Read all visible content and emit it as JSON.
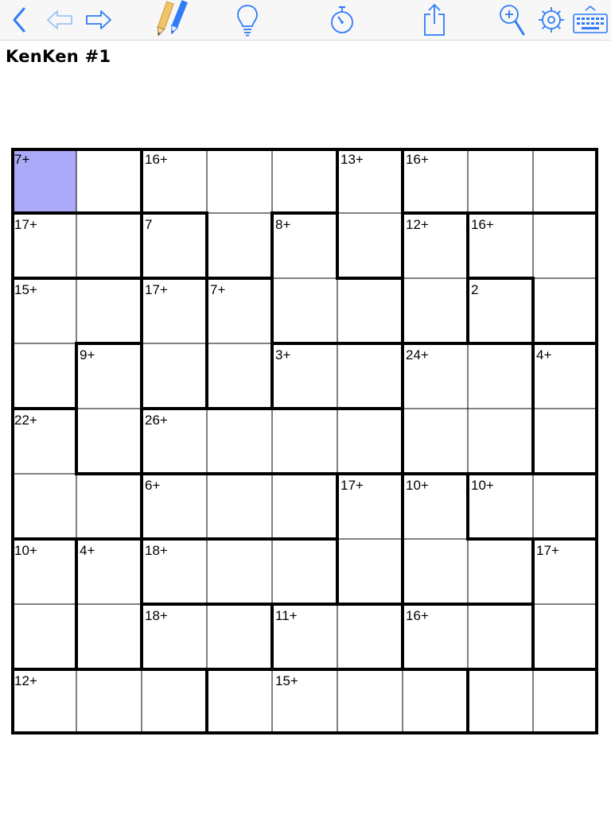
{
  "toolbar": {
    "back": "back-icon",
    "undo": "undo-arrow-icon",
    "redo": "redo-arrow-icon",
    "pencil": "pencil-icon",
    "hint": "lightbulb-icon",
    "timer": "stopwatch-icon",
    "share": "share-icon",
    "zoom": "zoom-in-icon",
    "settings": "gear-icon",
    "keyboard": "keyboard-icon",
    "accent_color": "#2f7cf6"
  },
  "puzzle": {
    "title": "KenKen #1",
    "size": 9,
    "selected_cell": [
      0,
      0
    ],
    "selected_color": "#aaaaf8",
    "cages": [
      {
        "label": "7+",
        "cells": [
          [
            0,
            0
          ],
          [
            1,
            0
          ]
        ]
      },
      {
        "label": "16+",
        "cells": [
          [
            0,
            1
          ],
          [
            0,
            2
          ],
          [
            0,
            3
          ],
          [
            0,
            4
          ],
          [
            0,
            5
          ],
          [
            0,
            6
          ],
          [
            0,
            7
          ],
          [
            0,
            8
          ]
        ]
      },
      {
        "label": "16+",
        "cells": [
          [
            0,
            2
          ],
          [
            0,
            3
          ],
          [
            0,
            4
          ],
          [
            1,
            3
          ]
        ]
      },
      {
        "label": "13+",
        "cells": [
          [
            0,
            5
          ],
          [
            1,
            5
          ]
        ]
      },
      {
        "label": "16+",
        "cells": [
          [
            0,
            6
          ],
          [
            0,
            7
          ],
          [
            0,
            8
          ]
        ]
      },
      {
        "label": "17+",
        "cells": [
          [
            1,
            0
          ],
          [
            1,
            1
          ]
        ]
      },
      {
        "label": "7",
        "cells": [
          [
            1,
            2
          ]
        ]
      },
      {
        "label": "8+",
        "cells": [
          [
            1,
            4
          ],
          [
            2,
            4
          ],
          [
            2,
            5
          ]
        ]
      },
      {
        "label": "12+",
        "cells": [
          [
            1,
            6
          ],
          [
            2,
            6
          ]
        ]
      },
      {
        "label": "16+",
        "cells": [
          [
            1,
            7
          ],
          [
            1,
            8
          ],
          [
            2,
            8
          ]
        ]
      },
      {
        "label": "15+",
        "cells": [
          [
            2,
            0
          ],
          [
            2,
            1
          ],
          [
            3,
            0
          ]
        ]
      },
      {
        "label": "17+",
        "cells": [
          [
            2,
            2
          ],
          [
            3,
            2
          ]
        ]
      },
      {
        "label": "7+",
        "cells": [
          [
            2,
            3
          ],
          [
            3,
            3
          ]
        ]
      },
      {
        "label": "2",
        "cells": [
          [
            2,
            7
          ]
        ]
      },
      {
        "label": "9+",
        "cells": [
          [
            3,
            1
          ],
          [
            4,
            1
          ]
        ]
      },
      {
        "label": "3+",
        "cells": [
          [
            3,
            4
          ],
          [
            3,
            5
          ]
        ]
      },
      {
        "label": "24+",
        "cells": [
          [
            3,
            6
          ],
          [
            3,
            7
          ],
          [
            4,
            6
          ],
          [
            4,
            7
          ]
        ]
      },
      {
        "label": "4+",
        "cells": [
          [
            3,
            8
          ],
          [
            4,
            8
          ]
        ]
      },
      {
        "label": "22+",
        "cells": [
          [
            4,
            0
          ],
          [
            5,
            0
          ],
          [
            5,
            1
          ]
        ]
      },
      {
        "label": "26+",
        "cells": [
          [
            4,
            2
          ],
          [
            4,
            3
          ],
          [
            4,
            4
          ],
          [
            4,
            5
          ]
        ]
      },
      {
        "label": "6+",
        "cells": [
          [
            5,
            2
          ],
          [
            5,
            3
          ],
          [
            5,
            4
          ]
        ]
      },
      {
        "label": "17+",
        "cells": [
          [
            5,
            5
          ],
          [
            6,
            5
          ]
        ]
      },
      {
        "label": "10+",
        "cells": [
          [
            5,
            6
          ],
          [
            6,
            6
          ],
          [
            6,
            7
          ]
        ]
      },
      {
        "label": "10+",
        "cells": [
          [
            5,
            7
          ],
          [
            5,
            8
          ]
        ]
      },
      {
        "label": "10+",
        "cells": [
          [
            6,
            0
          ],
          [
            7,
            0
          ]
        ]
      },
      {
        "label": "4+",
        "cells": [
          [
            6,
            1
          ],
          [
            7,
            1
          ]
        ]
      },
      {
        "label": "18+",
        "cells": [
          [
            6,
            2
          ],
          [
            6,
            3
          ],
          [
            6,
            4
          ]
        ]
      },
      {
        "label": "17+",
        "cells": [
          [
            6,
            8
          ],
          [
            7,
            8
          ]
        ]
      },
      {
        "label": "18+",
        "cells": [
          [
            7,
            2
          ],
          [
            7,
            3
          ]
        ]
      },
      {
        "label": "11+",
        "cells": [
          [
            7,
            4
          ],
          [
            7,
            5
          ]
        ]
      },
      {
        "label": "16+",
        "cells": [
          [
            7,
            6
          ],
          [
            7,
            7
          ]
        ]
      },
      {
        "label": "12+",
        "cells": [
          [
            8,
            0
          ],
          [
            8,
            1
          ],
          [
            8,
            2
          ]
        ]
      },
      {
        "label": "15+",
        "cells": [
          [
            8,
            3
          ],
          [
            8,
            4
          ],
          [
            8,
            5
          ],
          [
            8,
            6
          ]
        ]
      }
    ],
    "clues": [
      {
        "r": 0,
        "c": 0,
        "label": "7+"
      },
      {
        "r": 0,
        "c": 2,
        "label": "16+"
      },
      {
        "r": 0,
        "c": 5,
        "label": "13+"
      },
      {
        "r": 0,
        "c": 6,
        "label": "16+"
      },
      {
        "r": 1,
        "c": 0,
        "label": "17+"
      },
      {
        "r": 1,
        "c": 2,
        "label": "7"
      },
      {
        "r": 1,
        "c": 4,
        "label": "8+"
      },
      {
        "r": 1,
        "c": 6,
        "label": "12+"
      },
      {
        "r": 1,
        "c": 7,
        "label": "16+"
      },
      {
        "r": 2,
        "c": 0,
        "label": "15+"
      },
      {
        "r": 2,
        "c": 2,
        "label": "17+"
      },
      {
        "r": 2,
        "c": 3,
        "label": "7+"
      },
      {
        "r": 2,
        "c": 7,
        "label": "2"
      },
      {
        "r": 3,
        "c": 1,
        "label": "9+"
      },
      {
        "r": 3,
        "c": 4,
        "label": "3+"
      },
      {
        "r": 3,
        "c": 6,
        "label": "24+"
      },
      {
        "r": 3,
        "c": 8,
        "label": "4+"
      },
      {
        "r": 4,
        "c": 0,
        "label": "22+"
      },
      {
        "r": 4,
        "c": 2,
        "label": "26+"
      },
      {
        "r": 5,
        "c": 2,
        "label": "6+"
      },
      {
        "r": 5,
        "c": 5,
        "label": "17+"
      },
      {
        "r": 5,
        "c": 6,
        "label": "10+"
      },
      {
        "r": 5,
        "c": 7,
        "label": "10+"
      },
      {
        "r": 6,
        "c": 0,
        "label": "10+"
      },
      {
        "r": 6,
        "c": 1,
        "label": "4+"
      },
      {
        "r": 6,
        "c": 2,
        "label": "18+"
      },
      {
        "r": 6,
        "c": 8,
        "label": "17+"
      },
      {
        "r": 7,
        "c": 2,
        "label": "18+"
      },
      {
        "r": 7,
        "c": 4,
        "label": "11+"
      },
      {
        "r": 7,
        "c": 6,
        "label": "16+"
      },
      {
        "r": 8,
        "c": 0,
        "label": "12+"
      },
      {
        "r": 8,
        "c": 4,
        "label": "15+"
      }
    ]
  }
}
